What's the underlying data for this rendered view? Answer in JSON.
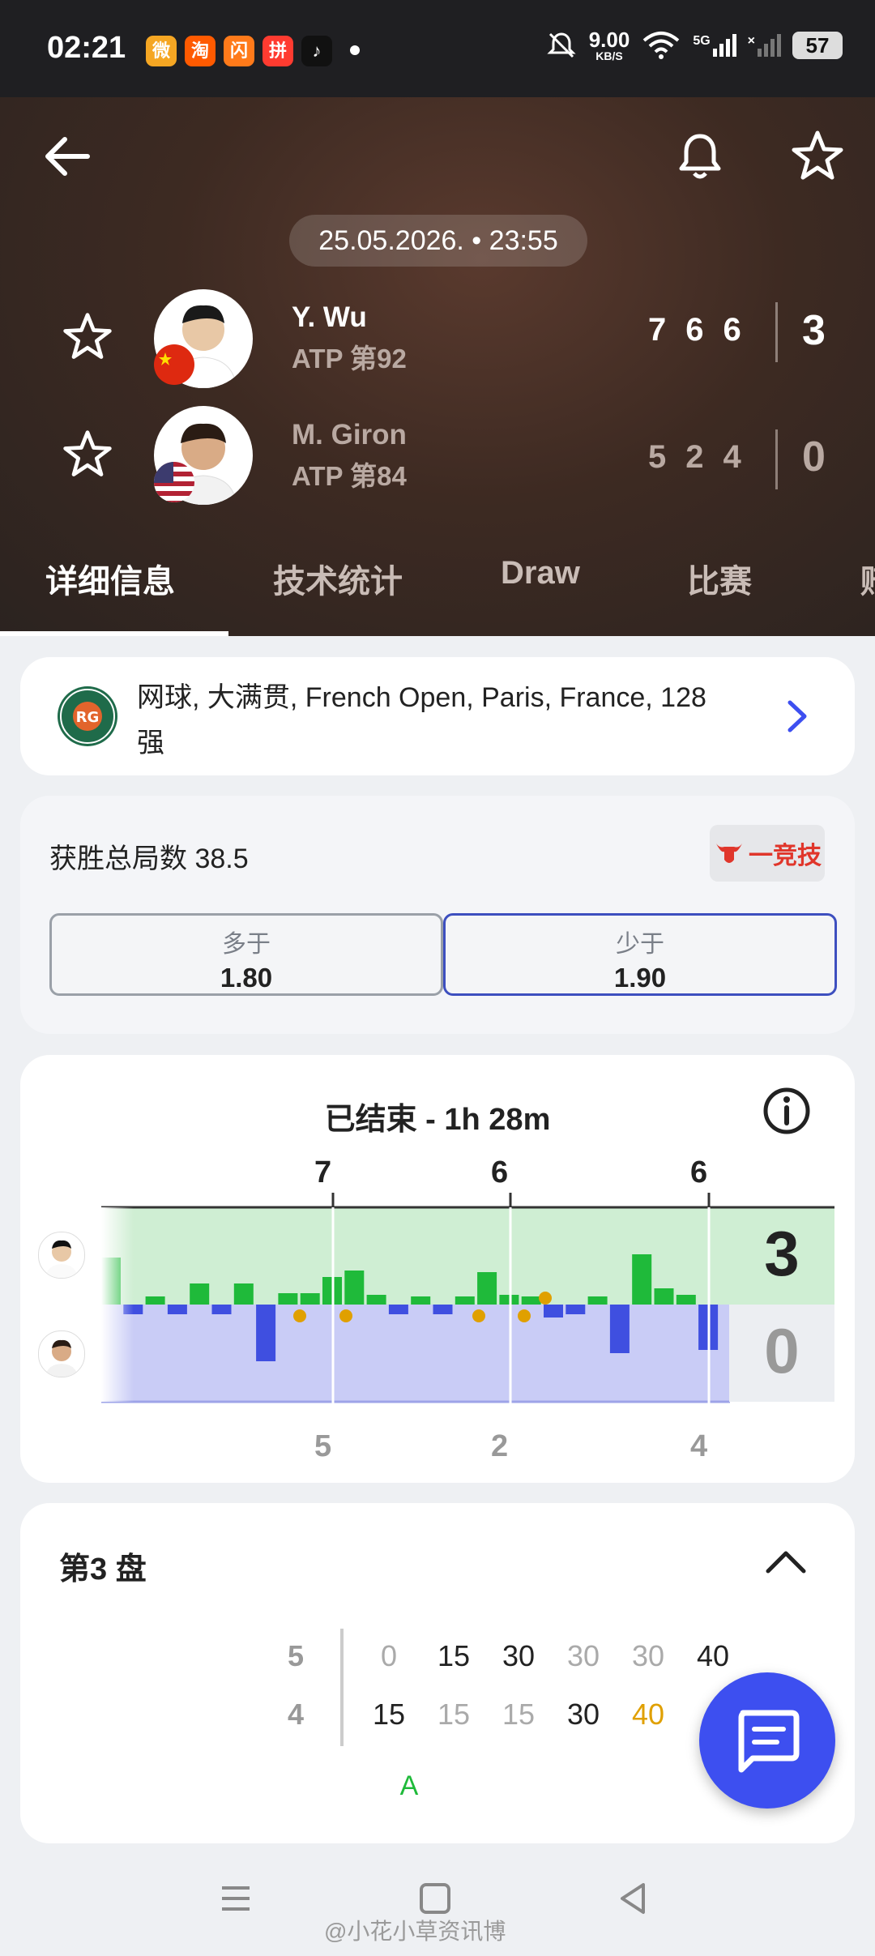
{
  "status_bar": {
    "time": "02:21",
    "net_speed": "9.00",
    "net_unit": "KB/S",
    "battery": "57",
    "network": "5G"
  },
  "header": {
    "datetime": "25.05.2026. • 23:55",
    "players": [
      {
        "name": "Y. Wu",
        "rank": "ATP 第92",
        "sets": [
          "7",
          "6",
          "6"
        ],
        "total": "3",
        "country": "China"
      },
      {
        "name": "M. Giron",
        "rank": "ATP 第84",
        "sets": [
          "5",
          "2",
          "4"
        ],
        "total": "0",
        "country": "USA"
      }
    ]
  },
  "tabs": [
    "详细信息",
    "技术统计",
    "Draw",
    "比赛",
    "赔"
  ],
  "tournament": {
    "line1": "网球, 大满贯, French Open, Paris, France, 128",
    "line2": "强"
  },
  "odds": {
    "title": "获胜总局数 38.5",
    "brand": "一竞技",
    "over_label": "多于",
    "over_value": "1.80",
    "under_label": "少于",
    "under_value": "1.90"
  },
  "momentum": {
    "status": "已结束 - 1h 28m",
    "top_sets": [
      "7",
      "6",
      "6"
    ],
    "bottom_sets": [
      "5",
      "2",
      "4"
    ],
    "score_top": "3",
    "score_bottom": "0"
  },
  "set_detail": {
    "title": "第3 盘",
    "row1": {
      "games": "5",
      "points": [
        "0",
        "15",
        "30",
        "30",
        "30",
        "40"
      ]
    },
    "row2": {
      "games": "4",
      "points": [
        "15",
        "15",
        "15",
        "30",
        "40"
      ]
    },
    "marker": "A"
  },
  "watermark": "@小花小草资讯博",
  "colors": {
    "accent": "#3d4ff0",
    "green": "#1fba3a",
    "blue": "#3f4fe0",
    "gold": "#e0a000"
  }
}
